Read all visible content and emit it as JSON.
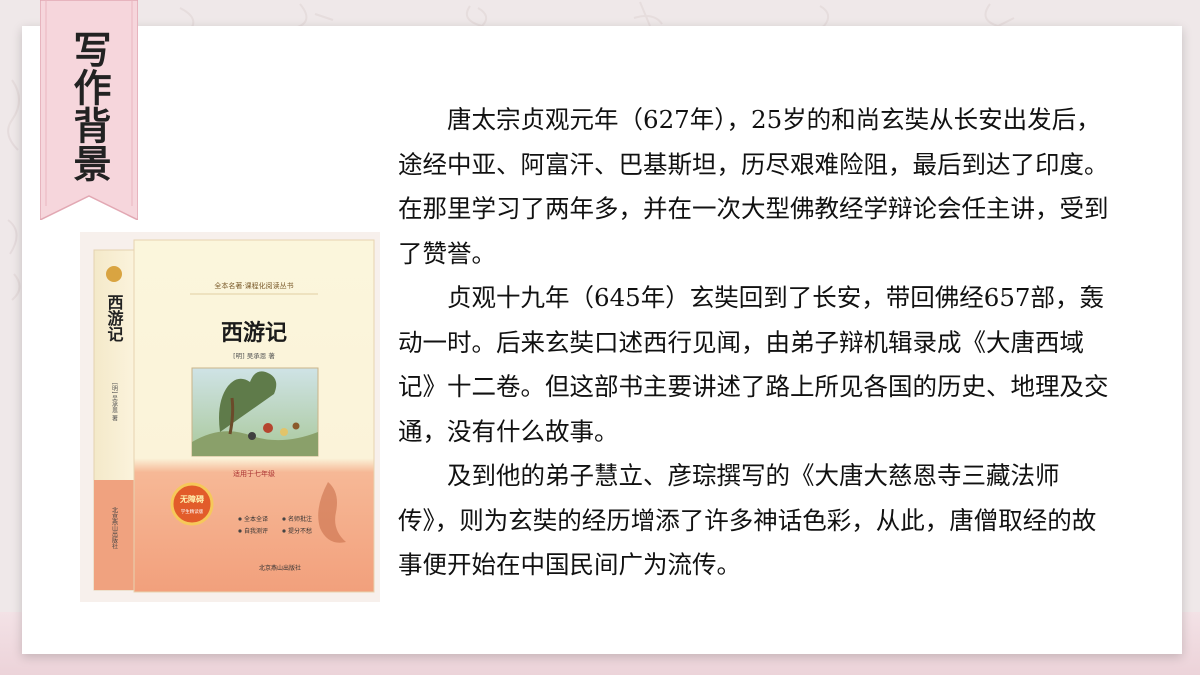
{
  "section_title": "写作背景",
  "book": {
    "series": "全本名著·课程化阅读丛书",
    "title": "西游记",
    "spine_title": "西游记",
    "author": "[明] 吴承恩 著",
    "spine_author": "[明] 吴承恩 著",
    "grade": "适用于七年级",
    "badge_main": "无障碍",
    "badge_sub": "学生精读版",
    "features": [
      "全本全译",
      "名师批注",
      "自我测评",
      "提分不愁"
    ],
    "publisher": "北京燕山出版社",
    "spine_publisher": "北京燕山出版社",
    "colors": {
      "cover_top": "#fbf6dc",
      "cover_bottom": "#f4a582",
      "accent": "#c0392b"
    }
  },
  "paragraphs": [
    "唐太宗贞观元年（627年），25岁的和尚玄奘从长安出发后，途经中亚、阿富汗、巴基斯坦，历尽艰难险阻，最后到达了印度。在那里学习了两年多，并在一次大型佛教经学辩论会任主讲，受到了赞誉。",
    "贞观十九年（645年）玄奘回到了长安，带回佛经657部，轰动一时。后来玄奘口述西行见闻，由弟子辩机辑录成《大唐西域记》十二卷。但这部书主要讲述了路上所见各国的历史、地理及交通，没有什么故事。",
    "及到他的弟子慧立、彦琮撰写的《大唐大慈恩寺三藏法师传》，则为玄奘的经历增添了许多神话色彩，从此，唐僧取经的故事便开始在中国民间广为流传。"
  ]
}
